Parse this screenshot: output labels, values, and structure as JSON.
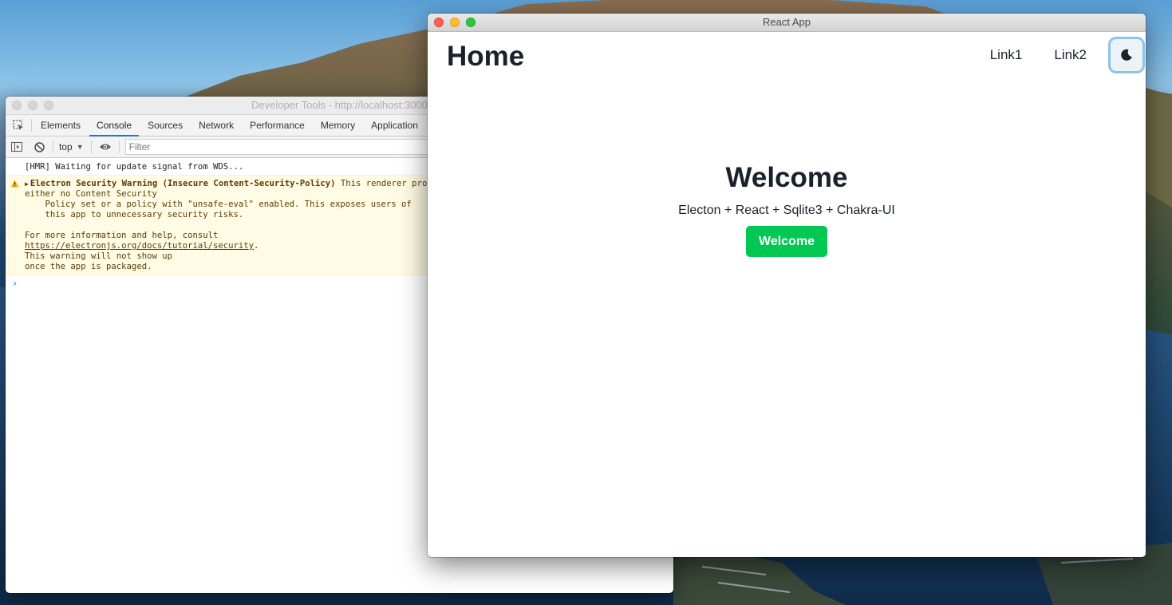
{
  "devtools": {
    "title": "Developer Tools - http://localhost:3000",
    "tabs": [
      "Elements",
      "Console",
      "Sources",
      "Network",
      "Performance",
      "Memory",
      "Application"
    ],
    "active_tab": "Console",
    "context": "top",
    "filter_placeholder": "Filter",
    "console": {
      "hmr_line": "[HMR] Waiting for update signal from WDS...",
      "warning": {
        "title": "Electron Security Warning (Insecure Content-Security-Policy)",
        "lead": " This renderer process has",
        "line2": "either no Content Security",
        "line3": "    Policy set or a policy with \"unsafe-eval\" enabled. This exposes users of",
        "line4": "    this app to unnecessary security risks.",
        "line5": "For more information and help, consult",
        "link": "https://electronjs.org/docs/tutorial/security",
        "link_suffix": ".",
        "line7": "This warning will not show up",
        "line8": "once the app is packaged."
      },
      "prompt": "›"
    }
  },
  "app": {
    "window_title": "React App",
    "header_title": "Home",
    "nav_links": [
      "Link1",
      "Link2"
    ],
    "theme_toggle_icon": "moon-icon",
    "hero": {
      "heading": "Welcome",
      "subtitle": "Electon + React + Sqlite3 + Chakra-UI",
      "button_label": "Welcome"
    },
    "accent_color": "#00c853"
  }
}
